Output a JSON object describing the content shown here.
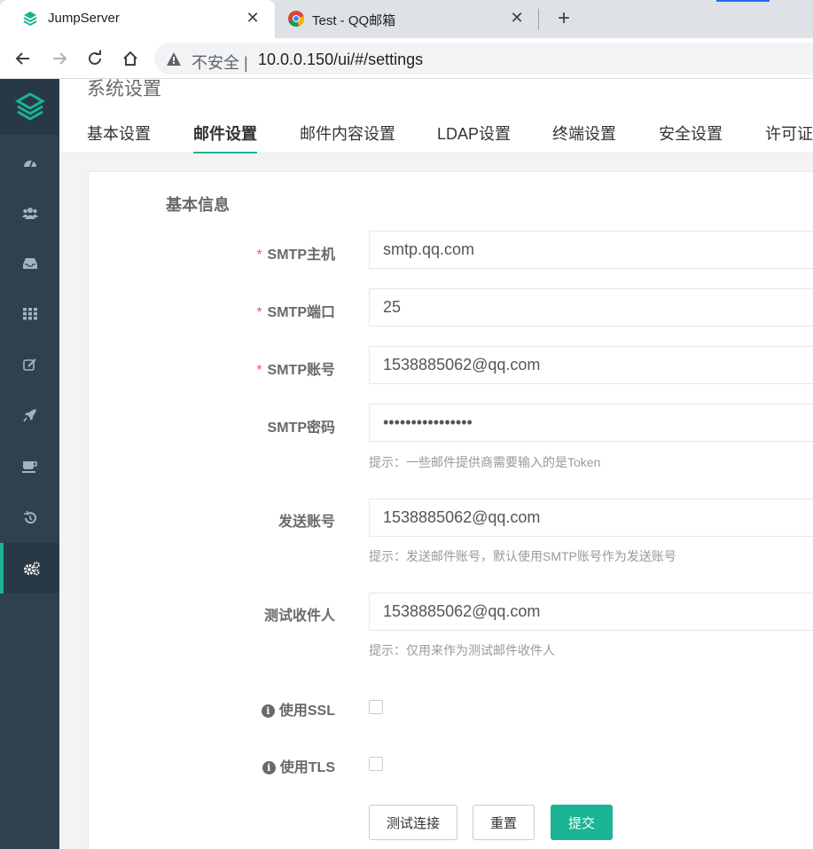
{
  "browser": {
    "tabs": [
      {
        "title": "JumpServer",
        "close": "✕"
      },
      {
        "title": "Test - QQ邮箱",
        "close": "✕"
      }
    ],
    "new_tab": "+",
    "insecure_label": "不安全 |",
    "url": "10.0.0.150/ui/#/settings"
  },
  "page": {
    "title": "系统设置",
    "tabs": [
      "基本设置",
      "邮件设置",
      "邮件内容设置",
      "LDAP设置",
      "终端设置",
      "安全设置",
      "许可证"
    ],
    "active_tab": 1
  },
  "form": {
    "section_title": "基本信息",
    "required_mark": "*",
    "smtp_host": {
      "label": "SMTP主机",
      "value": "smtp.qq.com"
    },
    "smtp_port": {
      "label": "SMTP端口",
      "value": "25"
    },
    "smtp_account": {
      "label": "SMTP账号",
      "value": "1538885062@qq.com"
    },
    "smtp_password": {
      "label": "SMTP密码",
      "value": "••••••••••••••••",
      "hint": "提示：一些邮件提供商需要输入的是Token"
    },
    "sender": {
      "label": "发送账号",
      "value": "1538885062@qq.com",
      "hint": "提示：发送邮件账号，默认使用SMTP账号作为发送账号"
    },
    "test_recipient": {
      "label": "测试收件人",
      "value": "1538885062@qq.com",
      "hint": "提示：仅用来作为测试邮件收件人"
    },
    "use_ssl": {
      "label": "使用SSL",
      "checked": false
    },
    "use_tls": {
      "label": "使用TLS",
      "checked": false
    },
    "info_glyph": "i"
  },
  "buttons": {
    "test": "测试连接",
    "reset": "重置",
    "submit": "提交"
  },
  "colors": {
    "accent": "#1ab394",
    "sidebar": "#2f4050",
    "required": "#ed5565"
  },
  "sidebar_icons": [
    "dashboard-icon",
    "users-icon",
    "assets-icon",
    "applications-icon",
    "perms-icon",
    "ops-icon",
    "terminal-icon",
    "audits-icon",
    "settings-icon"
  ]
}
